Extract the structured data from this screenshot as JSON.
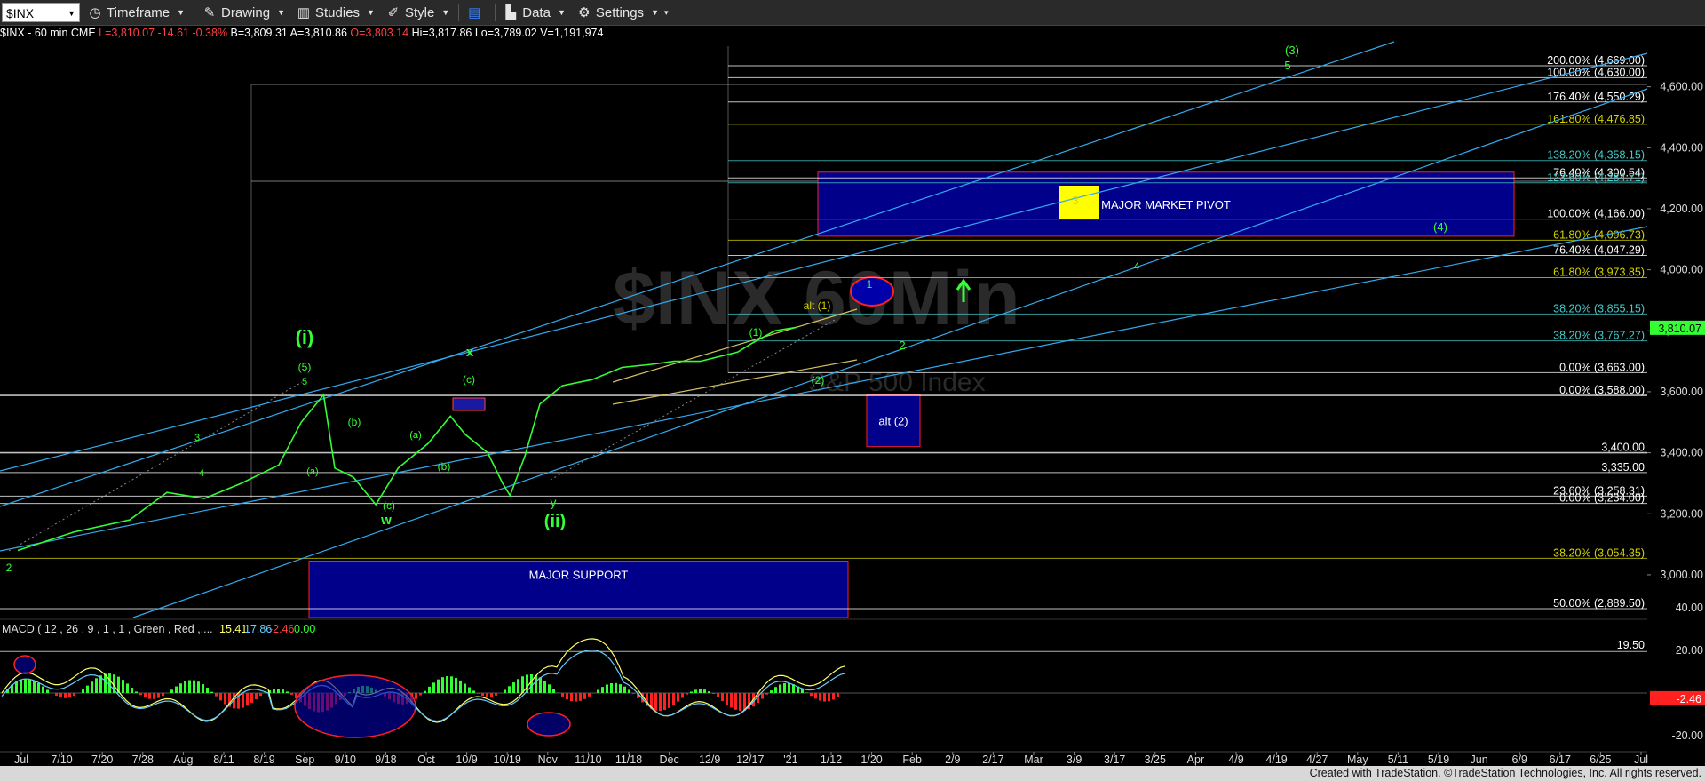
{
  "toolbar": {
    "symbol": "$INX",
    "timeframe_label": "Timeframe",
    "drawing_label": "Drawing",
    "studies_label": "Studies",
    "style_label": "Style",
    "data_label": "Data",
    "settings_label": "Settings"
  },
  "infoline": {
    "symbol_desc": "$INX - 60 min  CME",
    "last": "L=3,810.07  -14.61  -0.38%",
    "bid": "B=3,809.31",
    "ask": "A=3,810.86",
    "open": "O=3,803.14",
    "high": "Hi=3,817.86",
    "low": "Lo=3,789.02",
    "volume": "V=1,191,974"
  },
  "watermark": "$INX 60Min",
  "watermark_sub": "S&P 500 Index",
  "colors": {
    "price": "#33ff33",
    "channel": "#33aaee",
    "box": "#00008b",
    "box_border": "#ff2020"
  },
  "chart_data": [
    {
      "type": "line",
      "title": "$INX - 60 min",
      "x_ticks": [
        "Jul",
        "7/10",
        "7/20",
        "7/28",
        "Aug",
        "8/11",
        "8/19",
        "Sep",
        "9/10",
        "9/18",
        "Oct",
        "10/9",
        "10/19",
        "Nov",
        "11/10",
        "11/18",
        "Dec",
        "12/9",
        "12/17",
        "'21",
        "1/12",
        "1/20",
        "Feb",
        "2/9",
        "2/17",
        "Mar",
        "3/9",
        "3/17",
        "3/25",
        "Apr",
        "4/9",
        "4/19",
        "4/27",
        "May",
        "5/11",
        "5/19",
        "Jun",
        "6/9",
        "6/17",
        "6/25",
        "Jul"
      ],
      "y_ticks": [
        3000,
        3200,
        3400,
        3600,
        3800,
        4000,
        4200,
        4400,
        4600
      ],
      "y_tick_labels": [
        "3,000.00",
        "3,200.00",
        "3,400.00",
        "3,600.00",
        "3,800.00",
        "4,000.00",
        "4,200.00",
        "4,400.00",
        "4,600.00"
      ],
      "ylim": [
        2860,
        4730
      ],
      "last_price_label": "3,810.07",
      "price_path": [
        [
          0,
          3080
        ],
        [
          1.5,
          3140
        ],
        [
          3,
          3180
        ],
        [
          4,
          3270
        ],
        [
          5,
          3250
        ],
        [
          6,
          3300
        ],
        [
          7,
          3360
        ],
        [
          7.6,
          3500
        ],
        [
          8.2,
          3590
        ],
        [
          8.5,
          3350
        ],
        [
          9,
          3320
        ],
        [
          9.6,
          3230
        ],
        [
          10.2,
          3350
        ],
        [
          11,
          3430
        ],
        [
          11.6,
          3520
        ],
        [
          12,
          3460
        ],
        [
          12.6,
          3400
        ],
        [
          13,
          3300
        ],
        [
          13.2,
          3260
        ],
        [
          13.6,
          3390
        ],
        [
          14,
          3560
        ],
        [
          14.6,
          3620
        ],
        [
          15.4,
          3640
        ],
        [
          16.2,
          3680
        ],
        [
          17,
          3690
        ],
        [
          17.6,
          3700
        ],
        [
          18.3,
          3700
        ],
        [
          19.3,
          3730
        ],
        [
          19.7,
          3760
        ],
        [
          20.3,
          3800
        ],
        [
          20.9,
          3812
        ]
      ],
      "fib_levels": [
        {
          "label": "200.00% (4,669.00)",
          "value": 4669,
          "color": "#ffffff"
        },
        {
          "label": "100.00% (4,630.00)",
          "value": 4630,
          "color": "#ffffff"
        },
        {
          "label": "176.40% (4,550.29)",
          "value": 4550,
          "color": "#ffffff"
        },
        {
          "label": "161.80% (4,476.85)",
          "value": 4477,
          "color": "#d4d400"
        },
        {
          "label": "138.20% (4,358.15)",
          "value": 4358,
          "color": "#44cccc"
        },
        {
          "label": "76.40% (4,300.54)",
          "value": 4301,
          "color": "#ffffff"
        },
        {
          "label": "123.60% (4,284.71)",
          "value": 4285,
          "color": "#44cccc"
        },
        {
          "label": "100.00% (4,166.00)",
          "value": 4166,
          "color": "#ffffff"
        },
        {
          "label": "61.80% (4,096.73)",
          "value": 4097,
          "color": "#d4d400"
        },
        {
          "label": "76.40% (4,047.29)",
          "value": 4047,
          "color": "#ffffff"
        },
        {
          "label": "61.80% (3,973.85)",
          "value": 3974,
          "color": "#d4d400"
        },
        {
          "label": "38.20% (3,855.15)",
          "value": 3855,
          "color": "#44cccc"
        },
        {
          "label": "38.20% (3,767.27)",
          "value": 3767,
          "color": "#44cccc"
        },
        {
          "label": "0.00% (3,663.00)",
          "value": 3663,
          "color": "#ffffff"
        },
        {
          "label": "0.00% (3,588.00)",
          "value": 3588,
          "color": "#ffffff"
        },
        {
          "label": "3,400.00",
          "value": 3400,
          "color": "#ffffff"
        },
        {
          "label": "3,335.00",
          "value": 3335,
          "color": "#ffffff"
        },
        {
          "label": "23.60% (3,258.31)",
          "value": 3258,
          "color": "#ffffff"
        },
        {
          "label": "0.00% (3,234.00)",
          "value": 3234,
          "color": "#ffffff"
        },
        {
          "label": "38.20% (3,054.35)",
          "value": 3054,
          "color": "#d4d400"
        },
        {
          "label": "50.00% (2,889.50)",
          "value": 2889,
          "color": "#ffffff"
        }
      ],
      "zones": [
        {
          "label": "MAJOR MARKET PIVOT",
          "from": 4110,
          "to": 4320
        },
        {
          "label": "MAJOR SUPPORT",
          "from": 2860,
          "to": 3045
        },
        {
          "label": "alt (2)",
          "from": 3420,
          "to": 3590
        }
      ],
      "wave_labels": [
        {
          "text": "(3)",
          "color": "#33ff33"
        },
        {
          "text": "5",
          "color": "#33ff33"
        },
        {
          "text": "3",
          "color": "#d4d400"
        },
        {
          "text": "(4)",
          "color": "#33ff33"
        },
        {
          "text": "4",
          "color": "#33ff33"
        },
        {
          "text": "1",
          "color": "#33ff33"
        },
        {
          "text": "alt (1)",
          "color": "#d4d400"
        },
        {
          "text": "(1)",
          "color": "#33ff33"
        },
        {
          "text": "2",
          "color": "#33ff33"
        },
        {
          "text": "(2)",
          "color": "#33ff33"
        },
        {
          "text": "(i)",
          "color": "#33ff33"
        },
        {
          "text": "(5)",
          "color": "#33ff33"
        },
        {
          "text": "5",
          "color": "#33ff33"
        },
        {
          "text": "3",
          "color": "#33ff33"
        },
        {
          "text": "4",
          "color": "#33ff33"
        },
        {
          "text": "2",
          "color": "#33ff33"
        },
        {
          "text": "(b)",
          "color": "#33ff33"
        },
        {
          "text": "(a)",
          "color": "#33ff33"
        },
        {
          "text": "(c)",
          "color": "#33ff33"
        },
        {
          "text": "w",
          "color": "#33ff33"
        },
        {
          "text": "x",
          "color": "#33ff33"
        },
        {
          "text": "(c)",
          "color": "#33ff33"
        },
        {
          "text": "(a)",
          "color": "#33ff33"
        },
        {
          "text": "(b)",
          "color": "#33ff33"
        },
        {
          "text": "y",
          "color": "#33ff33"
        },
        {
          "text": "(ii)",
          "color": "#33ff33"
        }
      ]
    },
    {
      "type": "line",
      "title": "MACD ( 12 , 26 , 9 , 1 , 1 , Green , Red ,....",
      "values_text": [
        "15.41",
        "17.86",
        "-2.46",
        "0.00"
      ],
      "y_ticks": [
        40,
        20,
        -20
      ],
      "y_tick_labels": [
        "40.00",
        "20.00",
        "-20.00"
      ],
      "ref_level": {
        "label": "19.50",
        "value": 19.5
      },
      "last_label": "-2.46"
    }
  ],
  "footer": "Created with TradeStation. ©TradeStation Technologies, Inc. All rights reserved."
}
